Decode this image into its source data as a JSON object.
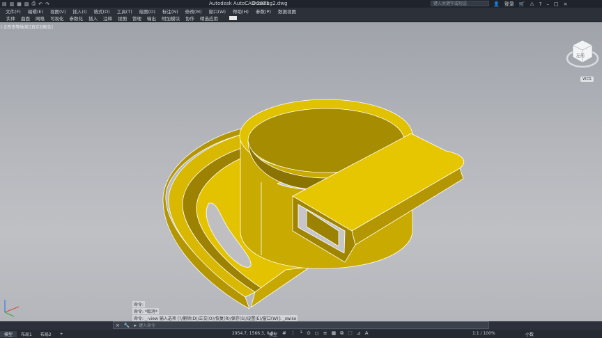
{
  "title_bar": {
    "quick_access_icons": [
      "new-icon",
      "open-icon",
      "save-icon",
      "saveas-icon",
      "print-icon",
      "undo-icon",
      "redo-icon"
    ],
    "app_title": "Autodesk AutoCAD 2021",
    "document_title": "Drawing2.dwg",
    "search_placeholder": "键入关键字或短语",
    "login_label": "登录",
    "cart_icon": "cart-icon",
    "help_icon": "help-icon"
  },
  "menu_bar": [
    "文件(F)",
    "编辑(E)",
    "视图(V)",
    "插入(I)",
    "格式(O)",
    "工具(T)",
    "绘图(D)",
    "标注(N)",
    "修改(M)",
    "窗口(W)",
    "帮助(H)",
    "参数(P)",
    "数据视图"
  ],
  "ribbon_tabs": [
    "实体",
    "曲面",
    "网格",
    "可视化",
    "参数化",
    "插入",
    "注释",
    "视图",
    "管理",
    "输出",
    "附加模块",
    "协作",
    "精选应用"
  ],
  "viewport": {
    "label": "[-][西南等轴测][真实][概念]",
    "wcs_label": "WCS",
    "viewcube_face": "左前"
  },
  "command": {
    "history": [
      "命令:",
      "命令: *取消*",
      "命令: _-view 输入选项 [?/删除(D)/正交(O)/恢复(R)/保存(S)/设置(E)/窗口(W)]: _swiso"
    ],
    "placeholder": "键入命令"
  },
  "status": {
    "layout_tabs": [
      "模型",
      "布局1",
      "布局2"
    ],
    "coords": "2954.7, 1566.3, 0.0",
    "mode": "模型",
    "zoom": "1:1 / 100%",
    "units": "小数"
  }
}
